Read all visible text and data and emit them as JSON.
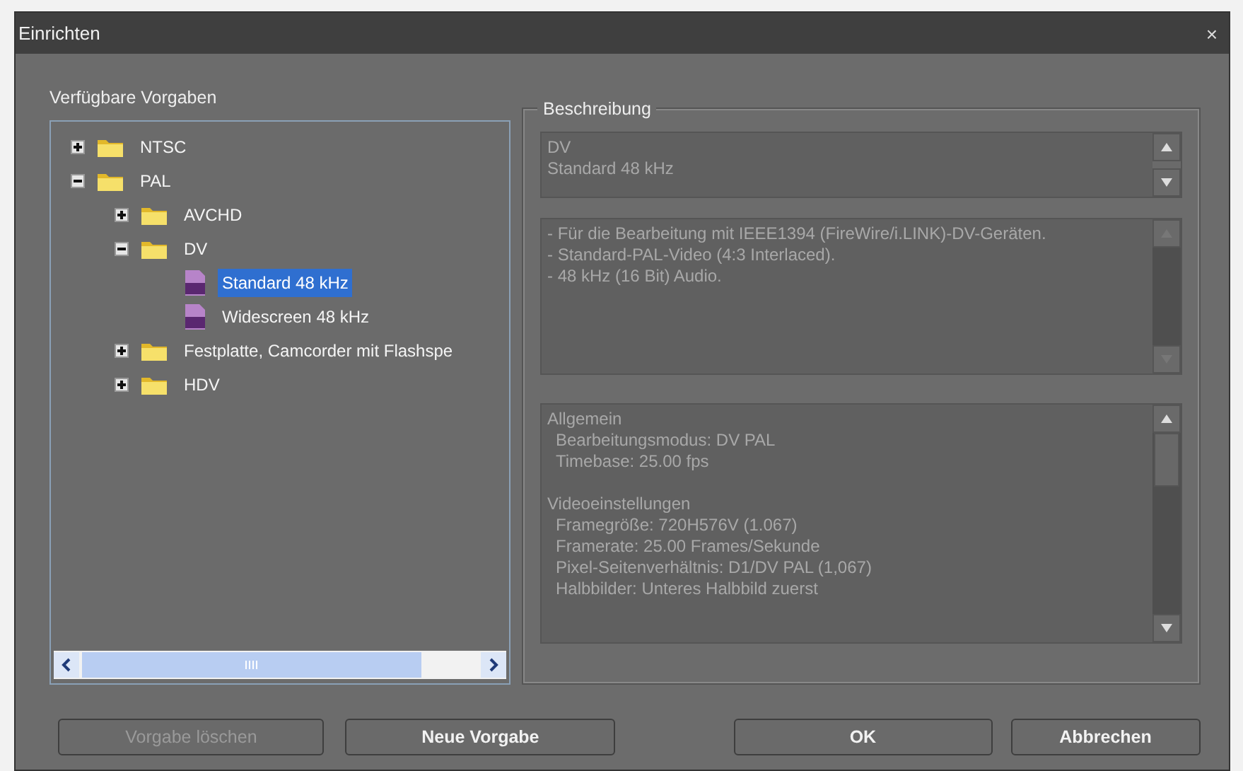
{
  "window": {
    "title": "Einrichten",
    "close": "×"
  },
  "presets": {
    "label": "Verfügbare Vorgaben",
    "tree": [
      {
        "label": "NTSC",
        "kind": "folder",
        "expanded": false,
        "selected": false
      },
      {
        "label": "PAL",
        "kind": "folder",
        "expanded": true,
        "selected": false,
        "children": [
          {
            "label": "AVCHD",
            "kind": "folder",
            "expanded": false,
            "selected": false
          },
          {
            "label": "DV",
            "kind": "folder",
            "expanded": true,
            "selected": false,
            "children": [
              {
                "label": "Standard 48 kHz",
                "kind": "preset",
                "selected": true
              },
              {
                "label": "Widescreen 48 kHz",
                "kind": "preset",
                "selected": false
              }
            ]
          },
          {
            "label": "Festplatte, Camcorder mit Flashspe",
            "kind": "folder",
            "expanded": false,
            "selected": false
          },
          {
            "label": "HDV",
            "kind": "folder",
            "expanded": false,
            "selected": false
          }
        ]
      }
    ]
  },
  "description": {
    "label": "Beschreibung",
    "name_lines": [
      "DV",
      "Standard 48 kHz"
    ],
    "summary_lines": [
      "- Für die Bearbeitung mit IEEE1394 (FireWire/i.LINK)-DV-Geräten.",
      "- Standard-PAL-Video (4:3 Interlaced).",
      "- 48 kHz (16 Bit) Audio."
    ],
    "details": [
      {
        "text": "Allgemein",
        "kind": "heading"
      },
      {
        "text": "Bearbeitungsmodus: DV PAL",
        "kind": "entry"
      },
      {
        "text": "Timebase: 25.00 fps",
        "kind": "entry"
      },
      {
        "kind": "blank"
      },
      {
        "text": "Videoeinstellungen",
        "kind": "heading"
      },
      {
        "text": "Framegröße: 720H576V (1.067)",
        "kind": "entry"
      },
      {
        "text": "Framerate: 25.00 Frames/Sekunde",
        "kind": "entry"
      },
      {
        "text": "Pixel-Seitenverhältnis: D1/DV PAL (1,067)",
        "kind": "entry"
      },
      {
        "text": "Halbbilder: Unteres Halbbild zuerst",
        "kind": "entry"
      }
    ]
  },
  "buttons": [
    {
      "label": "Vorgabe löschen",
      "disabled": true
    },
    {
      "label": "Neue Vorgabe",
      "disabled": false
    },
    {
      "label": "OK",
      "disabled": false
    },
    {
      "label": "Abbrechen",
      "disabled": false
    }
  ]
}
